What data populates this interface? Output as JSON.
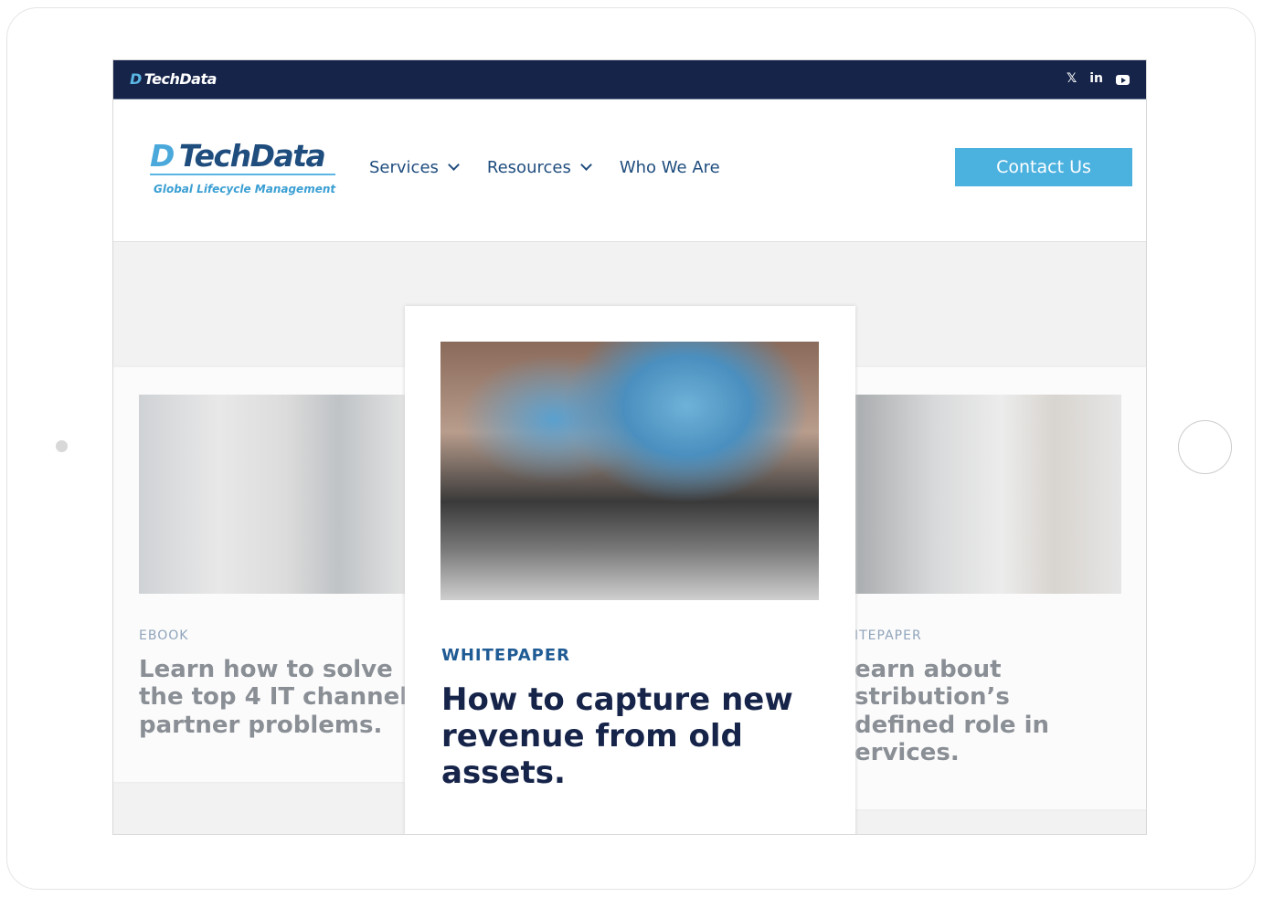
{
  "topbar": {
    "logo": "TechData",
    "social": [
      "twitter-icon",
      "linkedin-icon",
      "youtube-icon"
    ],
    "linkedin_text": "in",
    "twitter_text": "🐦"
  },
  "header": {
    "logo": "TechData",
    "logo_mark": "D",
    "tagline": "Global Lifecycle Management",
    "nav": [
      {
        "label": "Services"
      },
      {
        "label": "Resources"
      },
      {
        "label": "Who We Are"
      }
    ],
    "contact_label": "Contact Us"
  },
  "cards": [
    {
      "tag": "EBOOK",
      "title": "Learn how to solve the top 4 IT channel partner problems."
    },
    {
      "tag": "WHITEPAPER",
      "title": "How to capture new revenue from old assets."
    },
    {
      "tag": "ITEPAPER",
      "title_lines": [
        "earn about",
        "stribution’s",
        "defined role in",
        "ervices."
      ]
    }
  ],
  "colors": {
    "navy": "#16244a",
    "accent": "#4bb1df",
    "link": "#1f4d7e"
  }
}
